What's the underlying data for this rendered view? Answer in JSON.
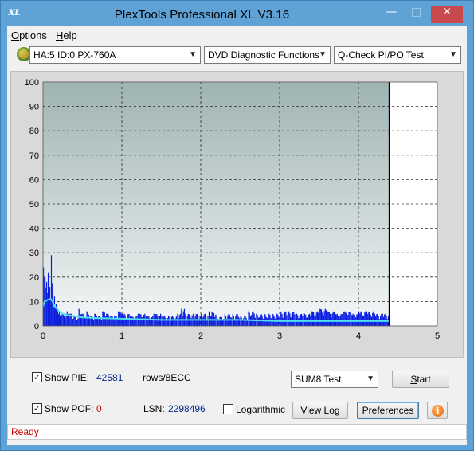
{
  "window": {
    "title": "PlexTools Professional XL V3.16",
    "app_icon_text": "XL",
    "controls": {
      "minimize": "—",
      "maximize": "□",
      "close": "✕"
    }
  },
  "menu": {
    "options": {
      "mnemonic": "O",
      "rest": "ptions"
    },
    "help": {
      "mnemonic": "H",
      "rest": "elp"
    }
  },
  "toolbar": {
    "drive": "HA:5 ID:0  PX-760A",
    "function": "DVD Diagnostic Functions",
    "test": "Q-Check PI/PO Test",
    "dropdown_icon": "⌄"
  },
  "chart_data": {
    "type": "bar",
    "title": "",
    "xlabel": "",
    "ylabel": "",
    "xlim": [
      0,
      5
    ],
    "ylim": [
      0,
      100
    ],
    "x_ticks": [
      "0",
      "1",
      "2",
      "3",
      "4",
      "5"
    ],
    "y_ticks": [
      "0",
      "10",
      "20",
      "30",
      "40",
      "50",
      "60",
      "70",
      "80",
      "90",
      "100"
    ],
    "grid": true,
    "data_end_x": 4.39,
    "colors": {
      "bars": "#0a1ee0",
      "avg_line": "#4fe0f0",
      "end_marker": "#000000",
      "plot_bg_top": "#9fb3b3",
      "plot_bg_bottom": "#f4f7f7",
      "panel_bg": "#d9d9d9"
    },
    "series": [
      {
        "kind": "bars",
        "x": [
          0.0,
          0.02,
          0.04,
          0.06,
          0.08,
          0.1,
          0.12,
          0.14,
          0.16,
          0.18,
          0.2,
          0.25,
          0.3,
          0.35,
          0.4,
          0.45,
          0.5,
          0.55,
          0.6,
          0.65,
          0.7,
          0.75,
          0.8,
          0.85,
          0.9,
          0.95,
          1.0,
          1.1,
          1.2,
          1.3,
          1.4,
          1.5,
          1.6,
          1.7,
          1.75,
          1.8,
          1.9,
          2.0,
          2.1,
          2.2,
          2.3,
          2.4,
          2.5,
          2.6,
          2.7,
          2.8,
          2.9,
          3.0,
          3.1,
          3.2,
          3.3,
          3.4,
          3.5,
          3.6,
          3.7,
          3.8,
          3.9,
          4.0,
          4.1,
          4.2,
          4.3,
          4.39
        ],
        "values": [
          24,
          20,
          18,
          22,
          16,
          29,
          14,
          12,
          9,
          7,
          6,
          5,
          6,
          5,
          4,
          7,
          5,
          6,
          4,
          5,
          4,
          6,
          5,
          4,
          4,
          6,
          5,
          4,
          5,
          4,
          5,
          4,
          4,
          5,
          7,
          5,
          5,
          5,
          6,
          4,
          5,
          5,
          4,
          6,
          5,
          5,
          5,
          6,
          6,
          5,
          5,
          6,
          7,
          6,
          5,
          6,
          5,
          6,
          6,
          5,
          5,
          8
        ]
      },
      {
        "kind": "line",
        "x": [
          0,
          0.02,
          0.05,
          0.08,
          0.1,
          0.12,
          0.15,
          0.2,
          0.25,
          0.3,
          0.4,
          0.5,
          0.7,
          1.0,
          1.5,
          2.0,
          2.5,
          3.0,
          3.5,
          4.0,
          4.39
        ],
        "values": [
          8,
          10,
          10.5,
          11,
          11,
          10,
          8,
          6,
          5,
          4.5,
          4,
          3.5,
          3.2,
          3,
          2.5,
          2.5,
          2.5,
          2,
          2,
          2,
          2
        ]
      }
    ]
  },
  "stats": {
    "show_pie_label": "Show PIE:",
    "pie_value": "42581",
    "pie_unit": "rows/8ECC",
    "show_pof_label": "Show POF:",
    "pof_value": "0",
    "lsn_label": "LSN:",
    "lsn_value": "2298496",
    "logarithmic_label": "Logarithmic",
    "checked_mark": "✓"
  },
  "controls": {
    "test_mode": "SUM8 Test",
    "start": {
      "mnemonic": "S",
      "rest": "tart"
    },
    "view_log": "View Log",
    "preferences": "Preferences",
    "info_icon_text": "i"
  },
  "status": {
    "text": "Ready"
  }
}
